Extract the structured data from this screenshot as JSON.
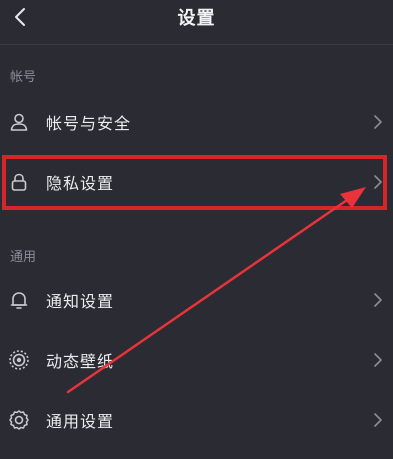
{
  "header": {
    "title": "设置"
  },
  "sections": {
    "account_label": "帐号",
    "general_label": "通用"
  },
  "items": {
    "account_security": "帐号与安全",
    "privacy": "隐私设置",
    "notifications": "通知设置",
    "live_wallpaper": "动态壁纸",
    "general": "通用设置"
  },
  "colors": {
    "background": "#2b2c33",
    "highlight": "#d6262a",
    "arrow": "#e8333a"
  },
  "icons": {
    "back": "chevron-left-icon",
    "account_security": "user-icon",
    "privacy": "lock-icon",
    "notifications": "bell-icon",
    "live_wallpaper": "wallpaper-icon",
    "general": "gear-icon",
    "row_chevron": "chevron-right-icon"
  }
}
